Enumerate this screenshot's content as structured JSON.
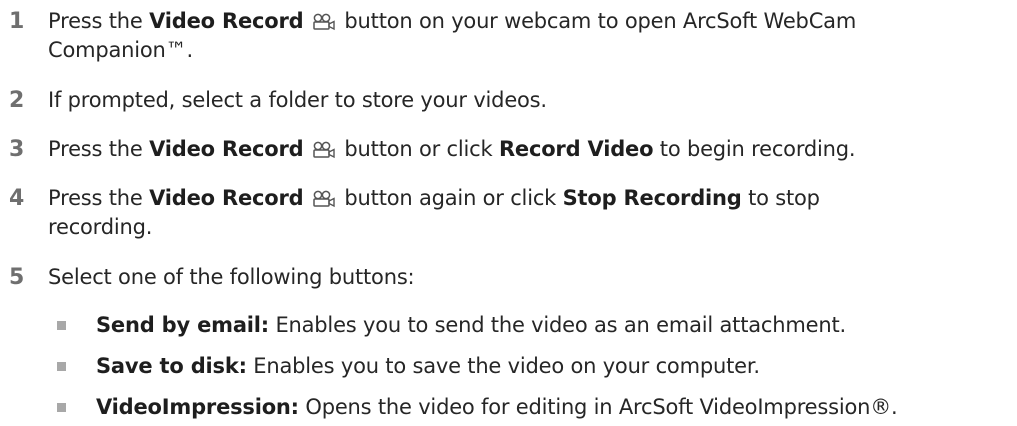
{
  "steps": [
    {
      "n": "1",
      "p1": "Press the ",
      "b1": "Video Record",
      "p2": " button on your webcam to open ArcSoft WebCam",
      "line2": "Companion™."
    },
    {
      "n": "2",
      "text": "If prompted, select a folder to store your videos."
    },
    {
      "n": "3",
      "p1": "Press the ",
      "b1": "Video Record",
      "p2": " button or click ",
      "b2": "Record Video",
      "p3": " to begin recording."
    },
    {
      "n": "4",
      "p1": "Press the ",
      "b1": "Video Record",
      "p2": " button again or click ",
      "b2": "Stop Recording",
      "p3": " to stop",
      "line2": "recording."
    },
    {
      "n": "5",
      "text": "Select one of the following buttons:"
    }
  ],
  "options": [
    {
      "label": "Send by email:",
      "desc": " Enables you to send the video as an email attachment."
    },
    {
      "label": "Save to disk:",
      "desc": " Enables you to save the video on your computer."
    },
    {
      "label": "VideoImpression:",
      "desc": " Opens the video for editing in ArcSoft VideoImpression®."
    }
  ],
  "icons": {
    "video_record": "video-camera-icon",
    "bullet": "square-bullet-icon"
  },
  "colors": {
    "number": "#6f6f6f",
    "bullet": "#a8a8a8",
    "text": "#262626"
  }
}
